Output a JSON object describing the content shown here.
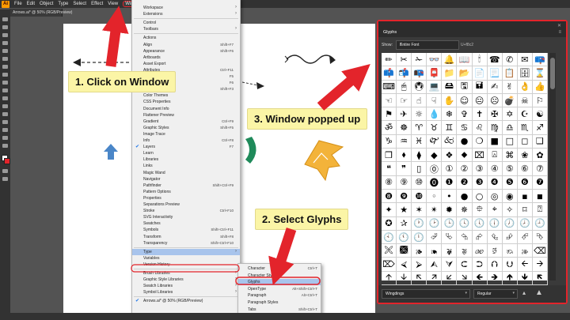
{
  "menubar": {
    "logo": "Ai",
    "items": [
      "File",
      "Edit",
      "Object",
      "Type",
      "Select",
      "Effect",
      "View",
      "Window"
    ]
  },
  "tab": {
    "label": "Arrows.ai* @ 50% (RGB/Preview)"
  },
  "window_menu": {
    "items": [
      {
        "label": "Workspace",
        "sub": true
      },
      {
        "label": "Extensions",
        "sub": true
      },
      {
        "label": "Control"
      },
      {
        "label": "Toolbars",
        "sub": true
      },
      {
        "label": "Actions"
      },
      {
        "label": "Align",
        "shortcut": "Shift+F7"
      },
      {
        "label": "Appearance",
        "shortcut": "Shift+F6"
      },
      {
        "label": "Artboards"
      },
      {
        "label": "Asset Export"
      },
      {
        "label": "Attributes",
        "shortcut": "Ctrl+F11"
      },
      {
        "label": "Brushes",
        "shortcut": "F5"
      },
      {
        "label": "Color",
        "shortcut": "F6"
      },
      {
        "label": "Color Guide",
        "shortcut": "Shift+F3"
      },
      {
        "label": "Color Themes"
      },
      {
        "label": "CSS Properties"
      },
      {
        "label": "Document Info"
      },
      {
        "label": "Flattener Preview"
      },
      {
        "label": "Gradient",
        "shortcut": "Ctrl+F9"
      },
      {
        "label": "Graphic Styles",
        "shortcut": "Shift+F5"
      },
      {
        "label": "Image Trace"
      },
      {
        "label": "Info",
        "shortcut": "Ctrl+F8"
      },
      {
        "label": "Layers",
        "shortcut": "F7",
        "checked": true
      },
      {
        "label": "Learn"
      },
      {
        "label": "Libraries"
      },
      {
        "label": "Links"
      },
      {
        "label": "Magic Wand"
      },
      {
        "label": "Navigator"
      },
      {
        "label": "Pathfinder",
        "shortcut": "Shift+Ctrl+F9"
      },
      {
        "label": "Pattern Options"
      },
      {
        "label": "Properties"
      },
      {
        "label": "Separations Preview"
      },
      {
        "label": "Stroke",
        "shortcut": "Ctrl+F10"
      },
      {
        "label": "SVG Interactivity"
      },
      {
        "label": "Swatches"
      },
      {
        "label": "Symbols",
        "shortcut": "Shift+Ctrl+F11"
      },
      {
        "label": "Transform",
        "shortcut": "Shift+F8"
      },
      {
        "label": "Transparency",
        "shortcut": "Shift+Ctrl+F10"
      },
      {
        "label": "Type",
        "sub": true,
        "highlight": true
      },
      {
        "label": "Variables"
      },
      {
        "label": "Version History"
      },
      {
        "label": "Brush Libraries",
        "sub": true
      },
      {
        "label": "Graphic Style Libraries",
        "sub": true
      },
      {
        "label": "Swatch Libraries",
        "sub": true
      },
      {
        "label": "Symbol Libraries",
        "sub": true
      },
      {
        "label": "Arrows.ai* @ 50% (RGB/Preview)",
        "checked": true
      }
    ]
  },
  "type_submenu": {
    "items": [
      {
        "label": "Character",
        "shortcut": "Ctrl+T"
      },
      {
        "label": "Character Styles"
      },
      {
        "label": "Glyphs",
        "highlight": true
      },
      {
        "label": "OpenType",
        "shortcut": "Alt+Shift+Ctrl+T"
      },
      {
        "label": "Paragraph",
        "shortcut": "Alt+Ctrl+T"
      },
      {
        "label": "Paragraph Styles"
      },
      {
        "label": "Tabs",
        "shortcut": "Shift+Ctrl+T"
      }
    ]
  },
  "callouts": {
    "step1": "1. Click on Window",
    "step2": "2. Select Glyphs",
    "step3": "3. Window popped up"
  },
  "glyphs_panel": {
    "title": "Glyphs",
    "show_label": "Show:",
    "show_value": "Entire Font",
    "code": "U+f8c2",
    "font": "Wingdings",
    "style": "Regular",
    "glyphs": [
      "✏",
      "✂",
      "✁",
      "👓",
      "🔔",
      "📖",
      "🕯",
      "☎",
      "✆",
      "✉",
      "📪",
      "📫",
      "📬",
      "📭",
      "📮",
      "📁",
      "📂",
      "📄",
      "📃",
      "📋",
      "🗄",
      "⌛",
      "⌨",
      "🖱",
      "🖲",
      "💻",
      "🖴",
      "🖫",
      "🖬",
      "✍",
      "✌",
      "👌",
      "👍",
      "☜",
      "☞",
      "☝",
      "☟",
      "✋",
      "☺",
      "😐",
      "☹",
      "💣",
      "☠",
      "⚐",
      "⚑",
      "✈",
      "☼",
      "💧",
      "❄",
      "✞",
      "✝",
      "✠",
      "✡",
      "☪",
      "☯",
      "ॐ",
      "☸",
      "♈",
      "♉",
      "♊",
      "♋",
      "♌",
      "♍",
      "♎",
      "♏",
      "♐",
      "♑",
      "♒",
      "♓",
      "🙰",
      "🙵",
      "●",
      "❍",
      "■",
      "□",
      "◻",
      "❑",
      "❒",
      "⬧",
      "⧫",
      "◆",
      "❖",
      "⬥",
      "⌧",
      "⍓",
      "⌘",
      "❀",
      "✿",
      "❝",
      "❞",
      "▯",
      "⓪",
      "①",
      "②",
      "③",
      "④",
      "⑤",
      "⑥",
      "⑦",
      "⑧",
      "⑨",
      "⑩",
      "⓿",
      "❶",
      "❷",
      "❸",
      "❹",
      "❺",
      "❻",
      "❼",
      "❽",
      "❾",
      "❿",
      "◦",
      "•",
      "●",
      "○",
      "◎",
      "◉",
      "▪",
      "◾",
      "✦",
      "★",
      "✶",
      "✴",
      "✹",
      "✵",
      "⯐",
      "⌖",
      "✧",
      "⌑",
      "⍰",
      "✪",
      "✰",
      "🕐",
      "🕑",
      "🕒",
      "🕓",
      "🕔",
      "🕕",
      "🕖",
      "🕗",
      "🕘",
      "🕙",
      "🕚",
      "🕛",
      "⮰",
      "⮱",
      "⮲",
      "⮳",
      "⮴",
      "⮵",
      "⮶",
      "⮷",
      "🙪",
      "🙫",
      "🙕",
      "🙔",
      "🙗",
      "🙖",
      "🙐",
      "🙑",
      "🙒",
      "🙓",
      "⌫",
      "⌦",
      "⮘",
      "⮚",
      "⮙",
      "⮛",
      "⮈",
      "⮊",
      "⮉",
      "⮋",
      "🡨",
      "🡪",
      "🡩",
      "🡫",
      "🡬",
      "🡭",
      "🡯",
      "🡮",
      "🡸",
      "🡺",
      "🡹",
      "🡻",
      "🡼"
    ]
  }
}
